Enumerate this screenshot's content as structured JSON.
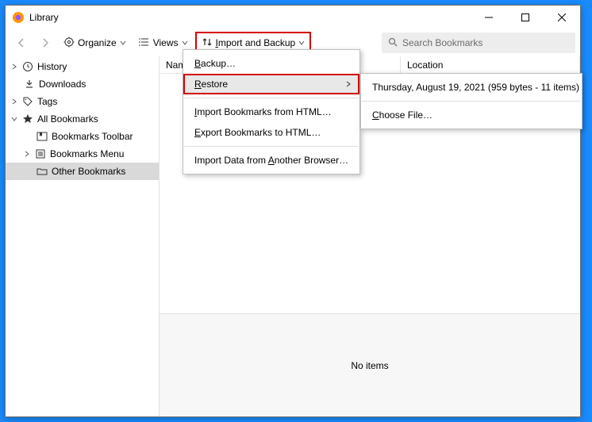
{
  "window": {
    "title": "Library"
  },
  "toolbar": {
    "organize": "Organize",
    "views": "Views",
    "import_backup": "Import and Backup"
  },
  "search": {
    "placeholder": "Search Bookmarks"
  },
  "sidebar": {
    "history": "History",
    "downloads": "Downloads",
    "tags": "Tags",
    "all_bookmarks": "All Bookmarks",
    "toolbar": "Bookmarks Toolbar",
    "menu": "Bookmarks Menu",
    "other": "Other Bookmarks"
  },
  "columns": {
    "name": "Name",
    "location": "Location"
  },
  "details": {
    "empty": "No items"
  },
  "menu_import": {
    "backup": "ackup…",
    "backup_u": "B",
    "restore": "estore",
    "restore_u": "R",
    "import_html": "mport Bookmarks from HTML…",
    "import_html_u": "I",
    "export_html": "xport Bookmarks to HTML…",
    "export_html_u": "E",
    "import_browser": "nother Browser…",
    "import_browser_pre": "Import Data from ",
    "import_browser_u": "A"
  },
  "menu_restore": {
    "item1": "Thursday, August 19, 2021 (959 bytes - 11 items)",
    "choose_pre": "hoose File…",
    "choose_u": "C"
  }
}
